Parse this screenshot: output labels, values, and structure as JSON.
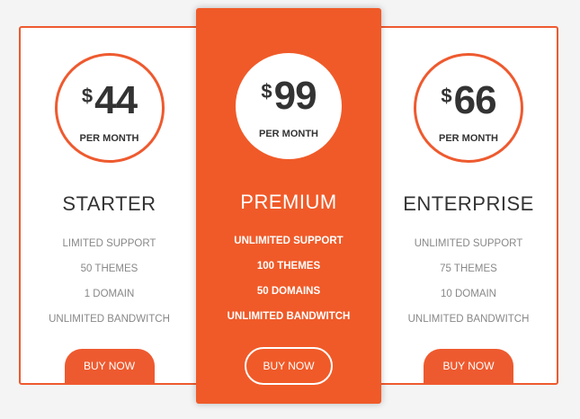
{
  "colors": {
    "accent": "#ee5a2f",
    "background": "#f4f4f4",
    "card": "#ffffff"
  },
  "plans": [
    {
      "name": "STARTER",
      "currency": "$",
      "price": "44",
      "period": "PER MONTH",
      "features": [
        "LIMITED SUPPORT",
        "50 THEMES",
        "1 DOMAIN",
        "UNLIMITED BANDWITCH"
      ],
      "button": "BUY NOW"
    },
    {
      "name": "PREMIUM",
      "currency": "$",
      "price": "99",
      "period": "PER MONTH",
      "features": [
        "UNLIMITED SUPPORT",
        "100 THEMES",
        "50 DOMAINS",
        "UNLIMITED BANDWITCH"
      ],
      "button": "BUY NOW"
    },
    {
      "name": "ENTERPRISE",
      "currency": "$",
      "price": "66",
      "period": "PER MONTH",
      "features": [
        "UNLIMITED SUPPORT",
        "75 THEMES",
        "10 DOMAIN",
        "UNLIMITED BANDWITCH"
      ],
      "button": "BUY NOW"
    }
  ]
}
